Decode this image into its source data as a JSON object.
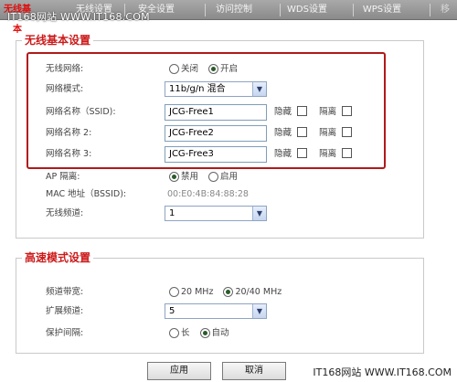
{
  "tabs": [
    {
      "label": "无线基本",
      "active": true
    },
    {
      "label": "无线设置",
      "active": false
    },
    {
      "label": "安全设置",
      "active": false
    },
    {
      "label": "访问控制",
      "active": false
    },
    {
      "label": "WDS设置",
      "active": false
    },
    {
      "label": "WPS设置",
      "active": false
    },
    {
      "label": "移",
      "active": false
    }
  ],
  "watermark_top": "IT168网站 WWW.IT168.COM",
  "watermark_bottom": "IT168网站 WWW.IT168.COM",
  "basic": {
    "title": "无线基本设置",
    "wireless_network": {
      "label": "无线网络:",
      "off": "关闭",
      "on": "开启",
      "selected": "开启"
    },
    "network_mode": {
      "label": "网络模式:",
      "value": "11b/g/n 混合"
    },
    "ssid1": {
      "label": "网络名称（SSID):",
      "value": "JCG-Free1",
      "hide": "隐藏",
      "isolate": "隔离"
    },
    "ssid2": {
      "label": "网络名称 2:",
      "value": "JCG-Free2",
      "hide": "隐藏",
      "isolate": "隔离"
    },
    "ssid3": {
      "label": "网络名称 3:",
      "value": "JCG-Free3",
      "hide": "隐藏",
      "isolate": "隔离"
    },
    "ap_isolation": {
      "label": "AP 隔离:",
      "disable": "禁用",
      "enable": "启用",
      "selected": "禁用"
    },
    "mac": {
      "label": "MAC 地址（BSSID):",
      "value": "00:E0:4B:84:88:28"
    },
    "channel": {
      "label": "无线频道:",
      "value": "1"
    }
  },
  "advanced": {
    "title": "高速模式设置",
    "bandwidth": {
      "label": "频道带宽:",
      "opt1": "20 MHz",
      "opt2": "20/40 MHz",
      "selected": "20/40 MHz"
    },
    "ext_channel": {
      "label": "扩展频道:",
      "value": "5"
    },
    "guard_interval": {
      "label": "保护间隔:",
      "long": "长",
      "auto": "自动",
      "selected": "自动"
    }
  },
  "buttons": {
    "apply": "应用",
    "cancel": "取消"
  },
  "colors": {
    "accent_red": "#cc1a1a",
    "highlight_border": "#b01a1a",
    "tabbar": "#9a9a9a"
  }
}
